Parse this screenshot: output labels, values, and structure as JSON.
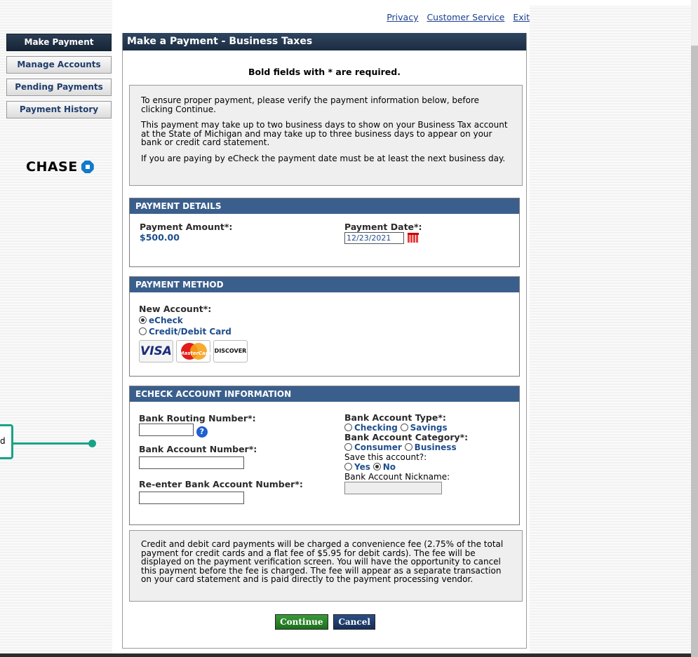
{
  "top_links": [
    "Privacy",
    "Customer Service",
    "Exit"
  ],
  "nav": {
    "items": [
      "Make Payment",
      "Manage Accounts",
      "Pending Payments",
      "Payment History"
    ]
  },
  "logo_text": "CHASE",
  "colors": {
    "header": "#1c2d42",
    "section_header": "#3a5f8d",
    "callout": "#17a385",
    "link": "#1a3f8f"
  },
  "main": {
    "title": "Make a Payment - Business Taxes",
    "required_note": "Bold fields with * are required.",
    "info": [
      "To ensure proper payment, please verify the payment information below, before clicking Continue.",
      "This payment may take up to two business days to show on your Business Tax account at the State of Michigan and may take up to three business days to appear on your bank or credit card statement.",
      "If you are paying by eCheck the payment date must be at least the next business day."
    ]
  },
  "payment_details": {
    "header": "PAYMENT DETAILS",
    "amount_label": "Payment Amount*:",
    "amount_value": "$500.00",
    "date_label": "Payment Date*:",
    "date_value": "12/23/2021"
  },
  "payment_method": {
    "header": "PAYMENT METHOD",
    "new_account_label": "New Account*:",
    "options": [
      "eCheck",
      "Credit/Debit Card"
    ],
    "selected": "eCheck",
    "cards": [
      "VISA",
      "MasterCard",
      "DISCOVER"
    ]
  },
  "echeck": {
    "header": "ECHECK ACCOUNT INFORMATION",
    "routing_label": "Bank Routing Number*:",
    "help_icon": "?",
    "account_label": "Bank Account Number*:",
    "reenter_label": "Re-enter Bank Account Number*:",
    "type_label": "Bank Account Type*:",
    "type_options": [
      "Checking",
      "Savings"
    ],
    "category_label": "Bank Account Category*:",
    "category_options": [
      "Consumer",
      "Business"
    ],
    "save_label": "Save this account?:",
    "save_options": [
      "Yes",
      "No"
    ],
    "save_selected": "No",
    "nickname_label": "Bank Account Nickname:"
  },
  "fee_notice": "Credit and debit card payments will be charged a convenience fee (2.75% of the total payment for credit cards and a flat fee of $5.95 for debit cards). The fee will be displayed on the payment verification screen. You will have the opportunity to cancel this payment before the fee is charged. The fee will appear as a separate transaction on your card statement and is paid directly to the payment processing vendor.",
  "buttons": {
    "continue": "Continue",
    "cancel": "Cancel"
  },
  "callout_text": "d"
}
